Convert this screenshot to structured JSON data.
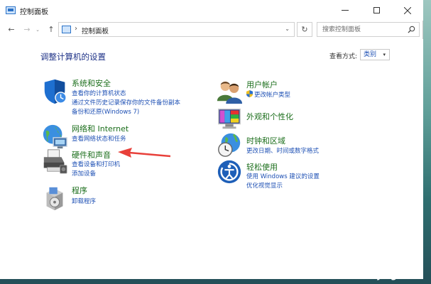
{
  "window": {
    "title": "控制面板"
  },
  "nav": {
    "back": "←",
    "forward": "→",
    "recent": "⌄",
    "up": "↑",
    "refresh": "↻"
  },
  "address": {
    "separator": "›",
    "path": "控制面板",
    "dropdown": "⌄"
  },
  "search": {
    "placeholder": "搜索控制面板"
  },
  "content": {
    "heading": "调整计算机的设置",
    "view_by_label": "查看方式:",
    "view_by_value": "类别",
    "view_by_arrow": "▾"
  },
  "categories": {
    "system": {
      "title": "系统和安全",
      "links": [
        "查看你的计算机状态",
        "通过文件历史记录保存你的文件备份副本",
        "备份和还原(Windows 7)"
      ]
    },
    "network": {
      "title": "网络和 Internet",
      "links": [
        "查看网络状态和任务"
      ]
    },
    "hardware": {
      "title": "硬件和声音",
      "links": [
        "查看设备和打印机",
        "添加设备"
      ]
    },
    "programs": {
      "title": "程序",
      "links": [
        "卸载程序"
      ]
    },
    "users": {
      "title": "用户帐户",
      "links": [
        "更改帐户类型"
      ]
    },
    "appearance": {
      "title": "外观和个性化",
      "links": []
    },
    "clock": {
      "title": "时钟和区域",
      "links": [
        "更改日期、时间或数字格式"
      ]
    },
    "ease": {
      "title": "轻松使用",
      "links": [
        "使用 Windows 建议的设置",
        "优化视觉显示"
      ]
    }
  },
  "watermark": {
    "cn": "爱纯净",
    "en": "aichunjing.com"
  },
  "colors": {
    "category_title": "#1b6e1b",
    "link": "#1e50b4",
    "heading": "#1e3287",
    "annotation_arrow": "#e8403a"
  }
}
